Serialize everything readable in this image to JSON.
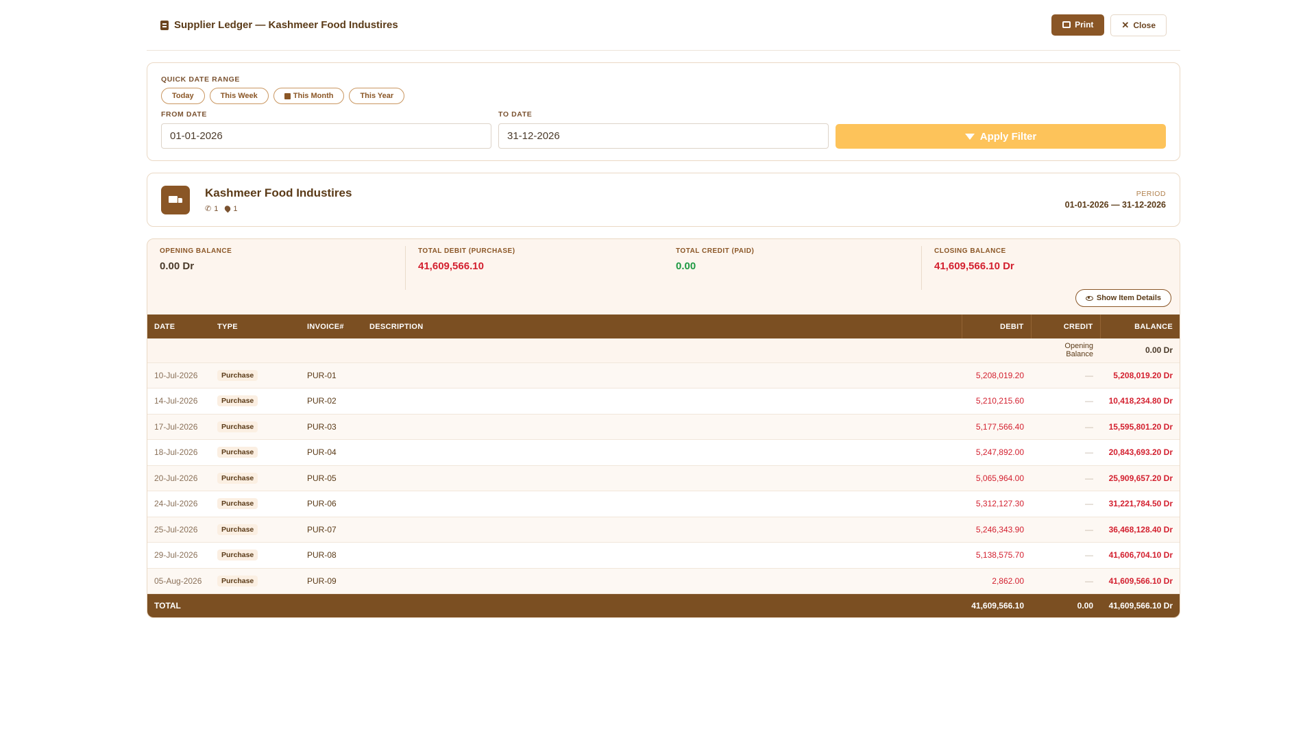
{
  "header": {
    "title": "Supplier Ledger — Kashmeer Food Industires",
    "print_label": "Print",
    "close_label": "Close"
  },
  "filter": {
    "quick_label": "QUICK DATE RANGE",
    "quick_ranges": [
      "Today",
      "This Week",
      "This Month",
      "This Year"
    ],
    "from_label": "FROM DATE",
    "from_value": "01-01-2026",
    "to_label": "TO DATE",
    "to_value": "31-12-2026",
    "apply_label": "Apply Filter"
  },
  "supplier": {
    "name": "Kashmeer Food Industires",
    "phone_count": "1",
    "location_count": "1",
    "period_label": "PERIOD",
    "period_value": "01-01-2026 — 31-12-2026"
  },
  "stats": {
    "opening_label": "OPENING BALANCE",
    "opening_value": "0.00 Dr",
    "debit_label": "TOTAL DEBIT (PURCHASE)",
    "debit_value": "41,609,566.10",
    "credit_label": "TOTAL CREDIT (PAID)",
    "credit_value": "0.00",
    "closing_label": "CLOSING BALANCE",
    "closing_value": "41,609,566.10 Dr"
  },
  "details_button": "Show Item Details",
  "table": {
    "headers": {
      "date": "DATE",
      "type": "TYPE",
      "invoice": "INVOICE#",
      "description": "DESCRIPTION",
      "debit": "DEBIT",
      "credit": "CREDIT",
      "balance": "BALANCE"
    },
    "opening_label": "Opening Balance",
    "opening_value": "0.00 Dr",
    "rows": [
      {
        "date": "10-Jul-2026",
        "type": "Purchase",
        "invoice": "PUR-01",
        "description": "",
        "debit": "5,208,019.20",
        "credit": "—",
        "balance": "5,208,019.20 Dr"
      },
      {
        "date": "14-Jul-2026",
        "type": "Purchase",
        "invoice": "PUR-02",
        "description": "",
        "debit": "5,210,215.60",
        "credit": "—",
        "balance": "10,418,234.80 Dr"
      },
      {
        "date": "17-Jul-2026",
        "type": "Purchase",
        "invoice": "PUR-03",
        "description": "",
        "debit": "5,177,566.40",
        "credit": "—",
        "balance": "15,595,801.20 Dr"
      },
      {
        "date": "18-Jul-2026",
        "type": "Purchase",
        "invoice": "PUR-04",
        "description": "",
        "debit": "5,247,892.00",
        "credit": "—",
        "balance": "20,843,693.20 Dr"
      },
      {
        "date": "20-Jul-2026",
        "type": "Purchase",
        "invoice": "PUR-05",
        "description": "",
        "debit": "5,065,964.00",
        "credit": "—",
        "balance": "25,909,657.20 Dr"
      },
      {
        "date": "24-Jul-2026",
        "type": "Purchase",
        "invoice": "PUR-06",
        "description": "",
        "debit": "5,312,127.30",
        "credit": "—",
        "balance": "31,221,784.50 Dr"
      },
      {
        "date": "25-Jul-2026",
        "type": "Purchase",
        "invoice": "PUR-07",
        "description": "",
        "debit": "5,246,343.90",
        "credit": "—",
        "balance": "36,468,128.40 Dr"
      },
      {
        "date": "29-Jul-2026",
        "type": "Purchase",
        "invoice": "PUR-08",
        "description": "",
        "debit": "5,138,575.70",
        "credit": "—",
        "balance": "41,606,704.10 Dr"
      },
      {
        "date": "05-Aug-2026",
        "type": "Purchase",
        "invoice": "PUR-09",
        "description": "",
        "debit": "2,862.00",
        "credit": "—",
        "balance": "41,609,566.10 Dr"
      }
    ],
    "total_label": "TOTAL",
    "total_debit": "41,609,566.10",
    "total_credit": "0.00",
    "total_balance": "41,609,566.10 Dr"
  },
  "colors": {
    "brand": "#8a5626",
    "header_bg": "#7b4f22",
    "accent": "#fdc35a",
    "debit": "#d3202f",
    "credit": "#1f9a43"
  }
}
